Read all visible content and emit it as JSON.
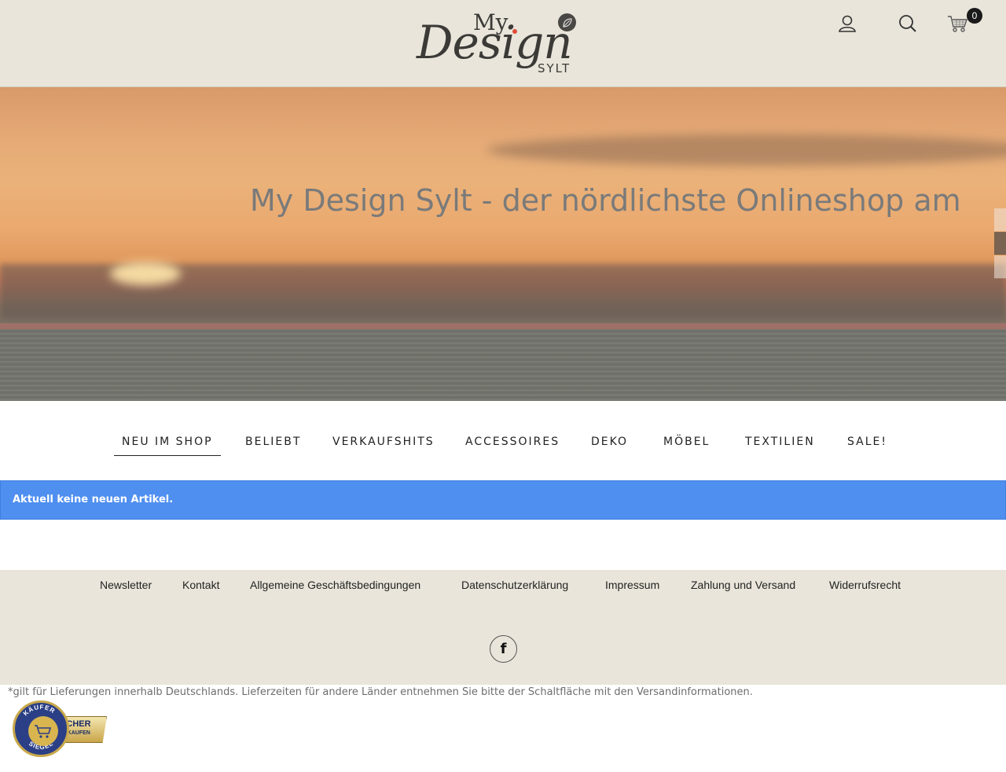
{
  "header": {
    "logo": {
      "line1": "My",
      "line2": "Design",
      "line3": "SYLT"
    },
    "icons": [
      "user-icon",
      "search-icon",
      "cart-icon"
    ],
    "cart_count": "0"
  },
  "hero": {
    "text": "My Design Sylt - der nördlichste Onlineshop am"
  },
  "tabs": [
    {
      "label": "NEU IM SHOP"
    },
    {
      "label": "BELIEBT"
    },
    {
      "label": "VERKAUFSHITS"
    },
    {
      "label": "ACCESSOIRES"
    },
    {
      "label": "DEKO"
    },
    {
      "label": "MÖBEL"
    },
    {
      "label": "TEXTILIEN"
    },
    {
      "label": "SALE!"
    }
  ],
  "info_message": "Aktuell keine neuen Artikel.",
  "footer": {
    "links": [
      "Newsletter",
      "Kontakt",
      "Allgemeine Geschäftsbedingungen",
      "Datenschutzerklärung",
      "Impressum",
      "Zahlung und Versand",
      "Widerrufsrecht"
    ],
    "social": [
      "facebook-icon"
    ]
  },
  "shipping_note": "*gilt für Lieferungen innerhalb Deutschlands. Lieferzeiten für andere Länder entnehmen Sie bitte der Schaltfläche mit den Versandinformationen.",
  "seal": {
    "ring_text": "KÄUFER SIEGEL",
    "line1": "SICHER",
    "line2": "EINKAUFEN"
  },
  "colors": {
    "header_bg": "#e9e5da",
    "info_bg": "#4f8ff0",
    "footer_bg": "#e9e5da"
  }
}
